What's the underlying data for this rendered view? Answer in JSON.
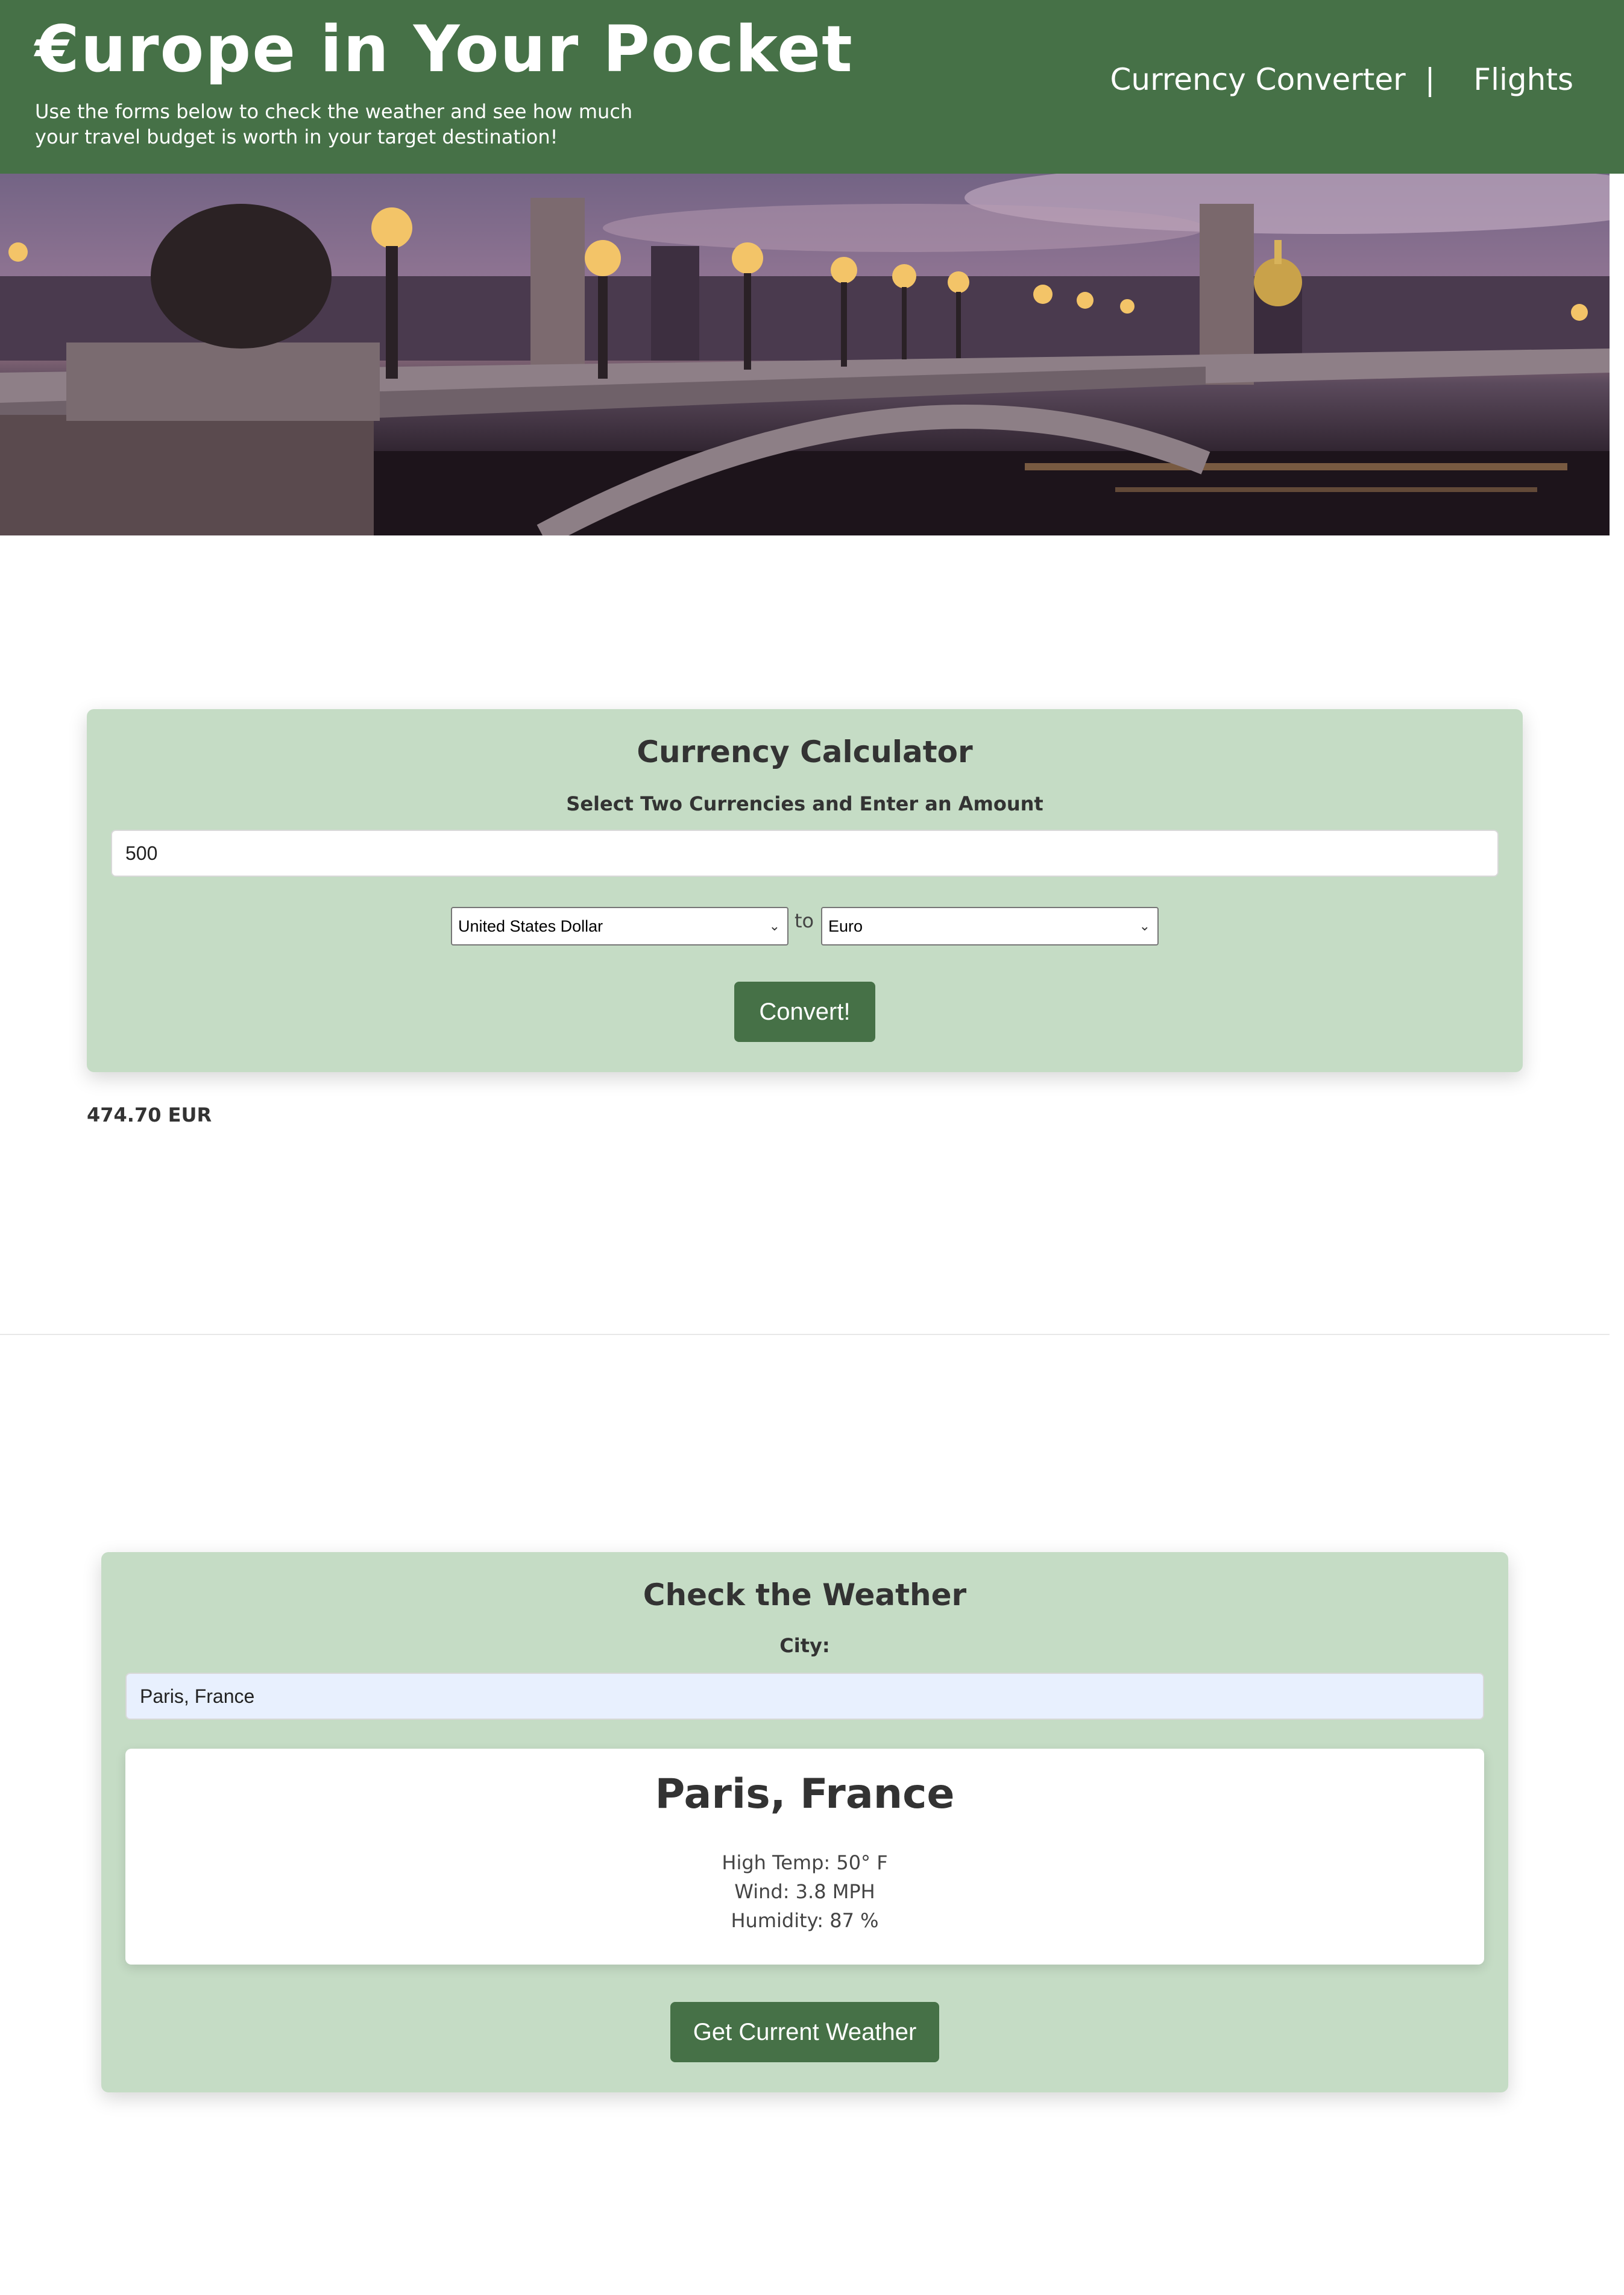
{
  "header": {
    "title": "€urope in Your Pocket",
    "tagline": "Use the forms below to check the weather and see how much your travel budget is worth in your target destination!",
    "nav": [
      {
        "label": "Currency Converter"
      },
      {
        "label": "Flights"
      }
    ],
    "nav_separator": "|"
  },
  "hero": {
    "icon": "bridge-at-dusk-photo"
  },
  "currency": {
    "title": "Currency Calculator",
    "subtitle": "Select Two Currencies and Enter an Amount",
    "amount_value": "500",
    "from_currency": "United States Dollar",
    "to_label": "to",
    "to_currency": "Euro",
    "convert_label": "Convert!",
    "result": "474.70 EUR"
  },
  "weather": {
    "title": "Check the Weather",
    "city_label": "City:",
    "city_value": "Paris, France",
    "result_city": "Paris, France",
    "high_temp": "High Temp: 50° F",
    "wind": "Wind: 3.8 MPH",
    "humidity": "Humidity: 87 %",
    "button_label": "Get Current Weather"
  },
  "colors": {
    "brand_green": "#467147",
    "card_green": "#c5dcc5",
    "input_focus": "#e8f0fe"
  }
}
